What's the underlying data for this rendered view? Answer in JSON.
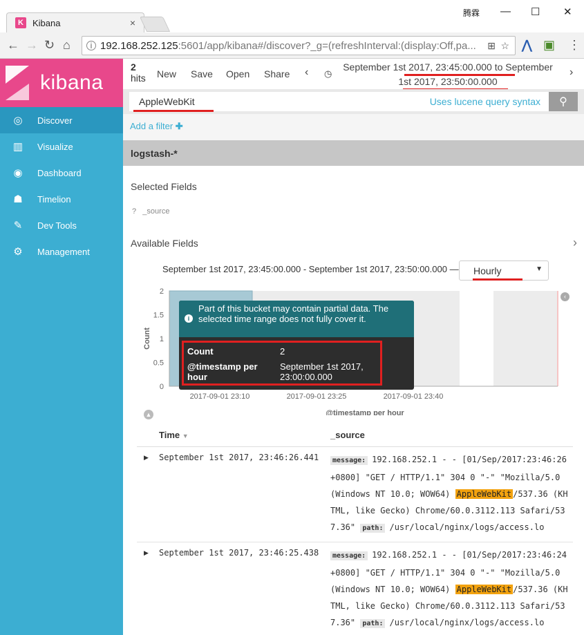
{
  "browser": {
    "tab_title": "Kibana",
    "tab_close": "×",
    "url_host": "192.168.252.125",
    "url_rest": ":5601/app/kibana#/discover?_g=(refreshInterval:(display:Off,pa...",
    "win_user": "腾霖",
    "win_min": "—",
    "win_max": "☐",
    "win_close": "✕"
  },
  "sidebar": {
    "brand": "kibana",
    "items": [
      {
        "label": "Discover",
        "icon": "compass-icon",
        "glyph": "◎",
        "active": true
      },
      {
        "label": "Visualize",
        "icon": "bar-chart-icon",
        "glyph": "▥"
      },
      {
        "label": "Dashboard",
        "icon": "dashboard-icon",
        "glyph": "◉"
      },
      {
        "label": "Timelion",
        "icon": "timelion-icon",
        "glyph": "☗"
      },
      {
        "label": "Dev Tools",
        "icon": "wrench-icon",
        "glyph": "✎"
      },
      {
        "label": "Management",
        "icon": "gear-icon",
        "glyph": "⚙"
      }
    ]
  },
  "topnav": {
    "hits_count": "2",
    "hits_label": "hits",
    "new": "New",
    "save": "Save",
    "open": "Open",
    "share": "Share",
    "time_range_line1": "September 1st 2017, 23:45:00.000 to September",
    "time_range_line2": "1st 2017, 23:50:00.000"
  },
  "query": {
    "value": "AppleWebKit",
    "lucene_hint": "Uses lucene query syntax"
  },
  "filter": {
    "add_label": "Add a filter"
  },
  "index_pattern": "logstash-*",
  "fields": {
    "selected_title": "Selected Fields",
    "source_type": "?",
    "source_name": "_source",
    "available_title": "Available Fields"
  },
  "histogram": {
    "range_text": "September 1st 2017, 23:45:00.000 - September 1st 2017, 23:50:00.000 —",
    "interval": "Hourly",
    "interval_caret": "▼"
  },
  "chart_data": {
    "type": "bar",
    "ylabel": "Count",
    "xlabel": "@timestamp per hour",
    "y_ticks": [
      "0",
      "0.5",
      "1",
      "1.5",
      "2"
    ],
    "ylim": [
      0,
      2
    ],
    "x_ticks": [
      "2017-09-01 23:10",
      "2017-09-01 23:25",
      "2017-09-01 23:40"
    ],
    "bars": [
      {
        "x": "September 1st 2017, 23:00:00.000",
        "value": 2
      }
    ]
  },
  "tooltip": {
    "info_glyph": "i",
    "warning": "Part of this bucket may contain partial data. The selected time range does not fully cover it.",
    "count_key": "Count",
    "count_value": "2",
    "ts_key": "@timestamp per hour",
    "ts_value": "September 1st 2017, 23:00:00.000"
  },
  "table": {
    "col_time": "Time",
    "col_source": "_source",
    "rows": [
      {
        "time": "September 1st 2017, 23:46:26.441",
        "message_key": "message:",
        "message_pre": "192.168.252.1 - - [01/Sep/2017:23:46:26 +0800] \"GET / HTTP/1.1\" 304 0 \"-\" \"Mozilla/5.0 (Windows NT 10.0; WOW64)",
        "highlight": "AppleWebKit",
        "message_post": "/537.36 (KHTML, like Gecko) Chrome/60.0.3112.113 Safari/537.36\"",
        "path_key": "path:",
        "path_value": "/usr/local/nginx/logs/access.lo"
      },
      {
        "time": "September 1st 2017, 23:46:25.438",
        "message_key": "message:",
        "message_pre": "192.168.252.1 - - [01/Sep/2017:23:46:24 +0800] \"GET / HTTP/1.1\" 304 0 \"-\" \"Mozilla/5.0 (Windows NT 10.0; WOW64)",
        "highlight": "AppleWebKit",
        "message_post": "/537.36 (KHTML, like Gecko) Chrome/60.0.3112.113 Safari/537.36\"",
        "path_key": "path:",
        "path_value": "/usr/local/nginx/logs/access.lo"
      }
    ]
  },
  "colors": {
    "brand_pink": "#e8488b",
    "sidebar_blue": "#3caed2",
    "highlight": "#f2a20f",
    "annotation_red": "#e02020"
  }
}
